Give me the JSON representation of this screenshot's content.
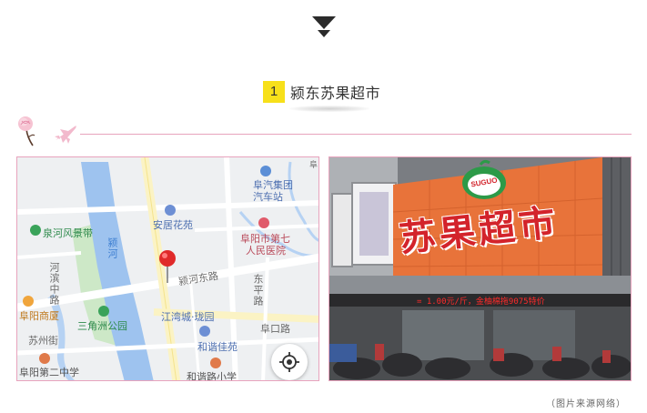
{
  "section": {
    "number": "1",
    "title": "颍东苏果超市"
  },
  "map": {
    "labels": {
      "fuyang_bus_group": "阜汽集团",
      "bus_station": "汽车站",
      "anju_garden": "安居花苑",
      "hospital_line1": "阜阳市第七",
      "hospital_line2": "人民医院",
      "quanhe_scenic": "泉河风景带",
      "ying_river": "颍河",
      "yinghe_east_road": "颍河东路",
      "hebin_road": "河滨中路",
      "east_road": "东平路",
      "fuyang_mall": "阜阳商厦",
      "sanjiaozhou_park": "三角洲公园",
      "jiangwan_city": "江湾城·珑园",
      "suzhou_street": "苏州街",
      "hexie_garden": "和谐佳苑",
      "fukou_road": "阜口路",
      "fuyang_no2_middle": "阜阳第二中学",
      "hexie_road_primary": "和谐路小学",
      "top_right_corner": "阜"
    }
  },
  "photo": {
    "store_sign": "苏果超市",
    "logo_text": "SUGUO",
    "led_ticker": "= 1.00元/斤，金柚棉拖9075特价"
  },
  "caption": "（图片来源网络）",
  "colors": {
    "accent_pink": "#e8a3bd",
    "badge_yellow": "#f7e01a",
    "facade_orange": "#e8733a",
    "sign_red": "#d3232b",
    "led_red": "#ff2a2a"
  }
}
